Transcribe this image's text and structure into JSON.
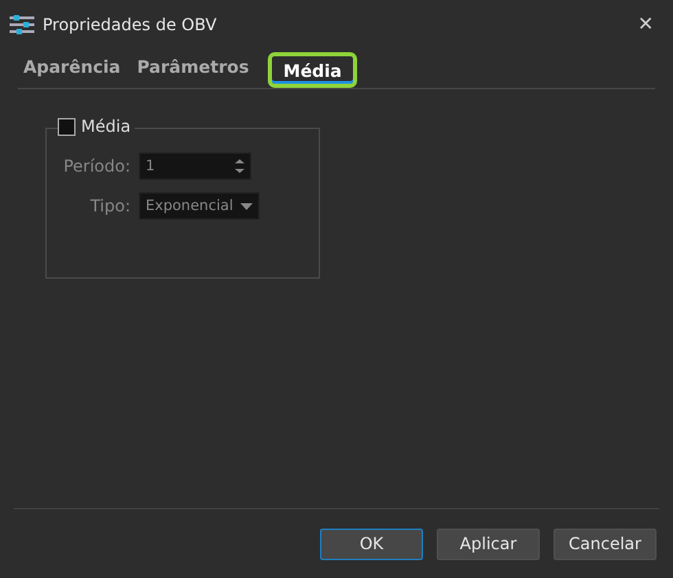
{
  "window": {
    "title": "Propriedades de OBV",
    "close": "✕"
  },
  "tabs": [
    {
      "label": "Aparência",
      "selected": false,
      "highlighted": false
    },
    {
      "label": "Parâmetros",
      "selected": false,
      "highlighted": false
    },
    {
      "label": "Média",
      "selected": true,
      "highlighted": true
    }
  ],
  "group": {
    "label": "Média",
    "checked": false,
    "fields": [
      {
        "kind": "spin",
        "label": "Período:",
        "value": "1",
        "disabled": true
      },
      {
        "kind": "dropdown",
        "label": "Tipo:",
        "value": "Exponencial",
        "disabled": true
      }
    ]
  },
  "buttons": [
    {
      "label": "OK",
      "default": true
    },
    {
      "label": "Aplicar",
      "default": false
    },
    {
      "label": "Cancelar",
      "default": false
    }
  ]
}
